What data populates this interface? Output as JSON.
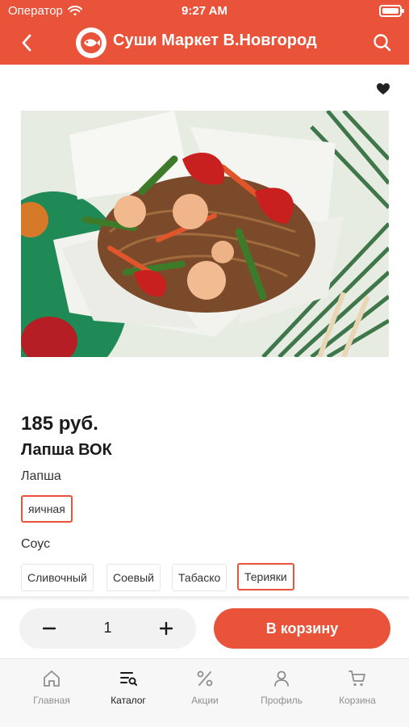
{
  "status_bar": {
    "carrier": "Оператор",
    "time": "9:27 AM"
  },
  "nav": {
    "title": "Суши Маркет В.Новгород"
  },
  "product": {
    "price": "185 руб.",
    "name": "Лапша ВОК",
    "noodle_group": {
      "label": "Лапша",
      "options": [
        "яичная"
      ],
      "selected": "яичная"
    },
    "sauce_group": {
      "label": "Соус",
      "options": [
        "Сливочный",
        "Соевый",
        "Табаско",
        "Терияки"
      ],
      "selected": "Терияки"
    }
  },
  "bottom": {
    "quantity": "1",
    "add_to_cart_label": "В корзину"
  },
  "tabs": [
    {
      "label": "Главная",
      "icon": "home-icon"
    },
    {
      "label": "Каталог",
      "icon": "catalog-icon",
      "active": true
    },
    {
      "label": "Акции",
      "icon": "percent-icon"
    },
    {
      "label": "Профиль",
      "icon": "profile-icon"
    },
    {
      "label": "Корзина",
      "icon": "cart-icon"
    }
  ],
  "colors": {
    "accent": "#e8533a",
    "tab_inactive": "#8f8f8f"
  }
}
